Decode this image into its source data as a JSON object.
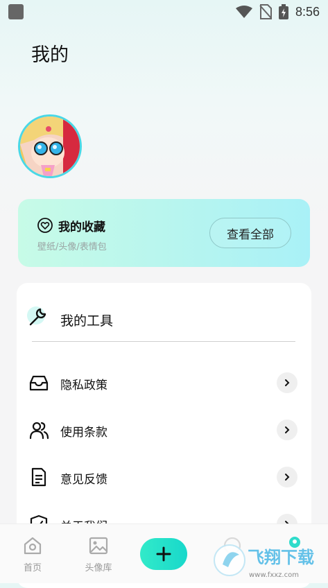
{
  "status_bar": {
    "time": "8:56"
  },
  "page": {
    "title": "我的"
  },
  "favorites": {
    "title": "我的收藏",
    "subtitle": "壁纸/头像/表情包",
    "view_all": "查看全部"
  },
  "tools": {
    "title": "我的工具",
    "items": [
      {
        "label": "隐私政策",
        "icon": "inbox-icon"
      },
      {
        "label": "使用条款",
        "icon": "users-icon"
      },
      {
        "label": "意见反馈",
        "icon": "document-icon"
      },
      {
        "label": "关于我们",
        "icon": "shield-icon"
      }
    ]
  },
  "tab_bar": {
    "home": "首页",
    "avatar_library": "头像库"
  },
  "watermark": {
    "text": "飞翔下载",
    "url": "www.fxxz.com"
  },
  "colors": {
    "accent": "#1edccb",
    "card_gradient_start": "#c7fbe7",
    "card_gradient_end": "#a9f1f7"
  }
}
